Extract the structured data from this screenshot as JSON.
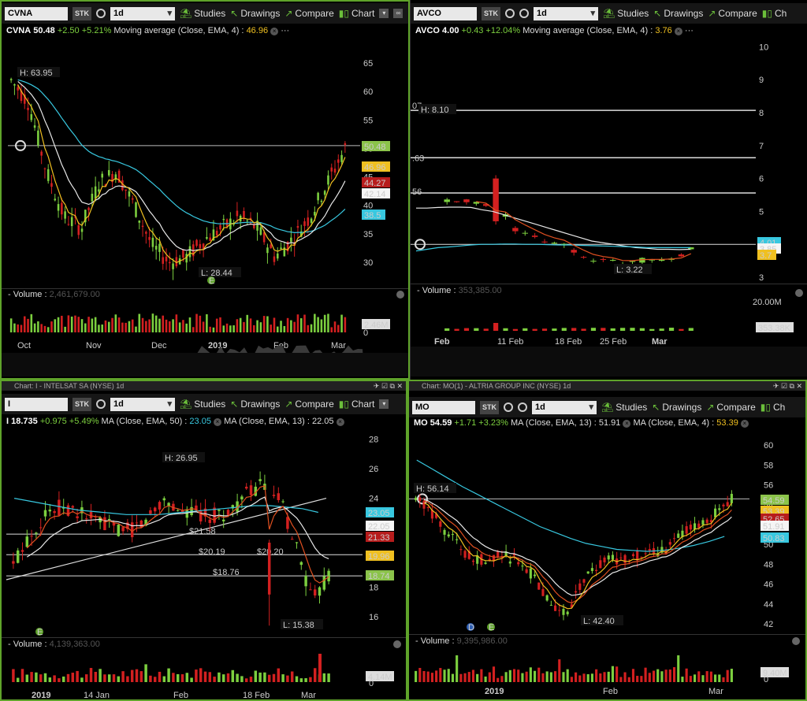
{
  "toolbar": {
    "studies": "Studies",
    "drawings": "Drawings",
    "compare": "Compare",
    "chart": "Chart",
    "chart_short": "Ch",
    "stk": "STK",
    "interval": "1d"
  },
  "panels": [
    {
      "symbol": "CVNA",
      "caption": "",
      "quote": {
        "symbol": "CVNA",
        "last": "50.48",
        "change": "+2.50",
        "pct": "+5.21%",
        "study1": "Moving average (Close, EMA, 4) :",
        "study1_val": "46.96"
      },
      "price_labels": [
        "65",
        "60",
        "55",
        "50",
        "45",
        "40",
        "35",
        "30"
      ],
      "high_label": "H: 63.95",
      "low_label": "L: 28.44",
      "tags": [
        "50.48",
        "46.96",
        "44.27",
        "42.14",
        "38.5"
      ],
      "volume_label": "Volume :",
      "volume_value": "2,461,679.00",
      "volume_tag": "2.46M",
      "volume_zero": "0",
      "date_labels": [
        "Oct",
        "Nov",
        "Dec",
        "2019",
        "Feb",
        "Mar"
      ],
      "event_marker": "E"
    },
    {
      "symbol": "AVCO",
      "caption": "",
      "quote": {
        "symbol": "AVCO",
        "last": "4.00",
        "change": "+0.43",
        "pct": "+12.04%",
        "study1": "Moving average (Close, EMA, 4) :",
        "study1_val": "3.76"
      },
      "price_labels": [
        "10",
        "9",
        "8",
        "7",
        "6",
        "5",
        "4",
        "3"
      ],
      "high_label": "H: 8.10",
      "low_label": "L: 3.22",
      "line_labels": [
        "07",
        ".63",
        "56"
      ],
      "tags": [
        "4.01",
        "3.85",
        "3.7"
      ],
      "volume_label": "Volume :",
      "volume_value": "353,385.00",
      "volume_tag": "353.38K",
      "volume_axis": "20.00M",
      "date_labels": [
        "Feb",
        "11 Feb",
        "18 Feb",
        "25 Feb",
        "Mar"
      ]
    },
    {
      "symbol": "I",
      "caption": "Chart: I - INTELSAT SA (NYSE) 1d",
      "quote": {
        "symbol": "I",
        "last": "18.735",
        "change": "+0.975",
        "pct": "+5.49%",
        "study1": "MA (Close, EMA, 50) :",
        "study1_val": "23.05",
        "study2": "MA (Close, EMA, 13) :",
        "study2_val": "22.05"
      },
      "price_labels": [
        "28",
        "26",
        "24",
        "22",
        "20",
        "18",
        "16"
      ],
      "high_label": "H: 26.95",
      "low_label": "L: 15.38",
      "line_labels": [
        "$21.58",
        "$20.19",
        "$20.20",
        "$18.76"
      ],
      "tags": [
        "23.05",
        "22.05",
        "21.33",
        "19.96",
        "18.74"
      ],
      "volume_label": "Volume :",
      "volume_value": "4,139,363.00",
      "volume_tag": "4.14M",
      "volume_zero": "0",
      "date_labels": [
        "2019",
        "14 Jan",
        "Feb",
        "18 Feb",
        "Mar"
      ],
      "event_marker": "E"
    },
    {
      "symbol": "MO",
      "caption": "Chart: MO(1) - ALTRIA GROUP INC (NYSE) 1d",
      "quote": {
        "symbol": "MO",
        "last": "54.59",
        "change": "+1.71",
        "pct": "+3.23%",
        "study1": "MA (Close, EMA, 13) :",
        "study1_val": "51.91",
        "study2": "MA (Close, EMA, 4) :",
        "study2_val": "53.39"
      },
      "price_labels": [
        "60",
        "58",
        "56",
        "54",
        "52",
        "50",
        "48",
        "46",
        "44",
        "42"
      ],
      "high_label": "H: 56.14",
      "low_label": "L: 42.40",
      "tags": [
        "54.59",
        "53.39",
        "52.65",
        "51.91",
        "50.83"
      ],
      "volume_label": "Volume :",
      "volume_value": "9,395,986.00",
      "volume_tag": "9.40M",
      "volume_zero": "0",
      "date_labels": [
        "2019",
        "Feb",
        "Mar"
      ],
      "event_markers": [
        "D",
        "E"
      ]
    }
  ],
  "colors": {
    "up": "#7ccf3f",
    "down": "#d32020",
    "ema_fast": "#f0c020",
    "ema_mid": "#e8e8e8",
    "ema_slow": "#38c8e0",
    "panel_border": "#5fa32a"
  }
}
